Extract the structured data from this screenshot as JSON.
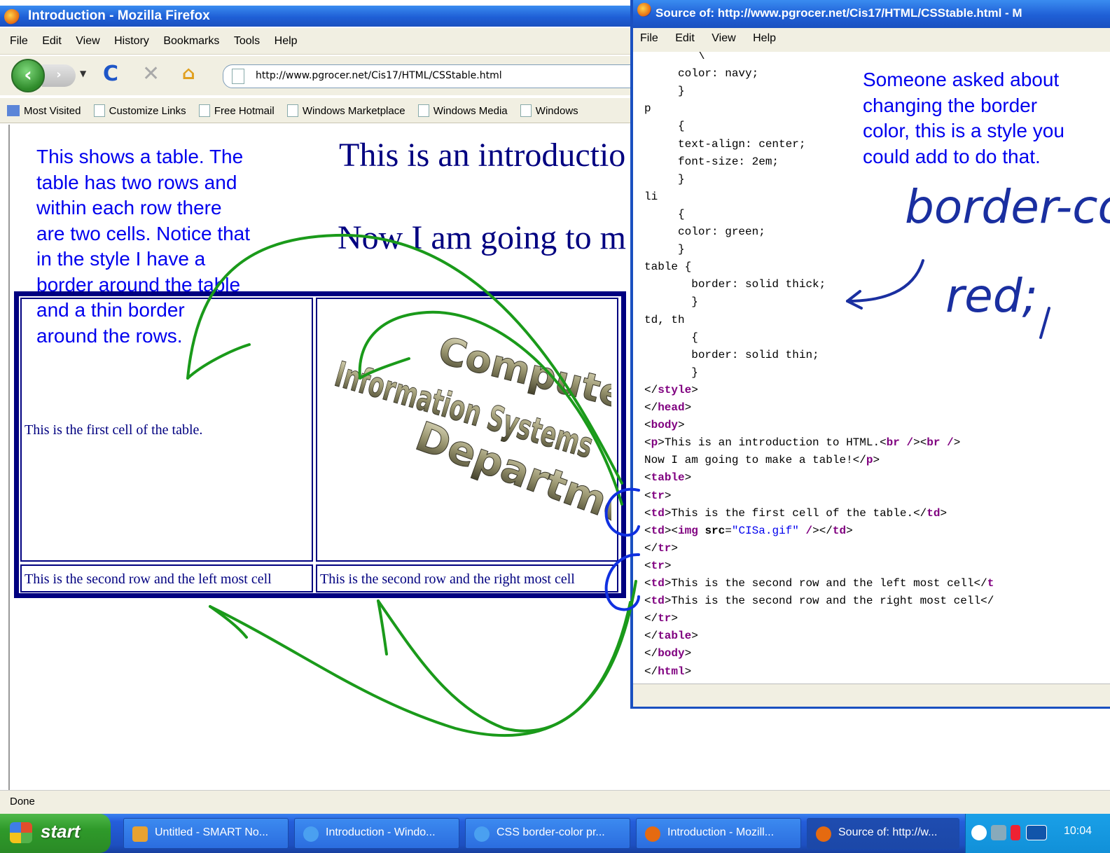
{
  "firefox": {
    "title": "Introduction - Mozilla Firefox",
    "menu": [
      "File",
      "Edit",
      "View",
      "History",
      "Bookmarks",
      "Tools",
      "Help"
    ],
    "url": "http://www.pgrocer.net/Cis17/HTML/CSStable.html",
    "bookmarks": [
      "Most Visited",
      "Customize Links",
      "Free Hotmail",
      "Windows Marketplace",
      "Windows Media",
      "Windows"
    ],
    "status": "Done"
  },
  "page": {
    "line1": "This is an introductio",
    "line2": "Now I am going to m",
    "cell1": "This is the first cell of the table.",
    "cell3": "This is the second row and the left most cell",
    "cell4": "This is the second row and the right most cell",
    "cis_words": [
      "Computer",
      "Information Systems",
      "Department"
    ]
  },
  "source": {
    "title": "Source of: http://www.pgrocer.net/Cis17/HTML/CSStable.html - M",
    "menu": [
      "File",
      "Edit",
      "View",
      "Help"
    ],
    "lines": [
      "        \\",
      "     color: navy;",
      "     }",
      "p",
      "     {",
      "     text-align: center;",
      "     font-size: 2em;",
      "     }",
      "li",
      "     {",
      "     color: green;",
      "     }",
      "table {",
      "       border: solid thick;",
      "       }",
      "td, th",
      "       {",
      "       border: solid thin;",
      "       }"
    ],
    "tail": [
      {
        "parts": [
          [
            "t",
            "</"
          ],
          [
            "g",
            "style"
          ],
          [
            "t",
            ">"
          ]
        ]
      },
      {
        "parts": [
          [
            "t",
            "</"
          ],
          [
            "g",
            "head"
          ],
          [
            "t",
            ">"
          ]
        ]
      },
      {
        "parts": [
          [
            "t",
            "<"
          ],
          [
            "g",
            "body"
          ],
          [
            "t",
            ">"
          ]
        ]
      },
      {
        "parts": [
          [
            "t",
            "<"
          ],
          [
            "g",
            "p"
          ],
          [
            "t",
            ">This is an introduction to HTML.<"
          ],
          [
            "g",
            "br"
          ],
          [
            "t",
            " "
          ],
          [
            "g",
            "/"
          ],
          [
            "t",
            "><"
          ],
          [
            "g",
            "br"
          ],
          [
            "t",
            " "
          ],
          [
            "g",
            "/"
          ],
          [
            "t",
            ">"
          ]
        ]
      },
      {
        "parts": [
          [
            "t",
            "Now I am going to make a table!</"
          ],
          [
            "g",
            "p"
          ],
          [
            "t",
            ">"
          ]
        ]
      },
      {
        "parts": [
          [
            "t",
            "<"
          ],
          [
            "g",
            "table"
          ],
          [
            "t",
            ">"
          ]
        ]
      },
      {
        "parts": [
          [
            "t",
            "<"
          ],
          [
            "g",
            "tr"
          ],
          [
            "t",
            ">"
          ]
        ]
      },
      {
        "parts": [
          [
            "t",
            "<"
          ],
          [
            "g",
            "td"
          ],
          [
            "t",
            ">This is the first cell of the table.</"
          ],
          [
            "g",
            "td"
          ],
          [
            "t",
            ">"
          ]
        ]
      },
      {
        "parts": [
          [
            "t",
            "<"
          ],
          [
            "g",
            "td"
          ],
          [
            "t",
            "><"
          ],
          [
            "g",
            "img"
          ],
          [
            "t",
            " "
          ],
          [
            "a",
            "src"
          ],
          [
            "t",
            "="
          ],
          [
            "s",
            "\"CISa.gif\""
          ],
          [
            "t",
            " "
          ],
          [
            "g",
            "/"
          ],
          [
            "t",
            "></"
          ],
          [
            "g",
            "td"
          ],
          [
            "t",
            ">"
          ]
        ]
      },
      {
        "parts": [
          [
            "t",
            "</"
          ],
          [
            "g",
            "tr"
          ],
          [
            "t",
            ">"
          ]
        ]
      },
      {
        "parts": [
          [
            "t",
            "<"
          ],
          [
            "g",
            "tr"
          ],
          [
            "t",
            ">"
          ]
        ]
      },
      {
        "parts": [
          [
            "t",
            "<"
          ],
          [
            "g",
            "td"
          ],
          [
            "t",
            ">This is the second row and the left most cell</"
          ],
          [
            "g",
            "t"
          ]
        ]
      },
      {
        "parts": [
          [
            "t",
            "<"
          ],
          [
            "g",
            "td"
          ],
          [
            "t",
            ">This is the second row and the right most cell</"
          ]
        ]
      },
      {
        "parts": [
          [
            "t",
            "</"
          ],
          [
            "g",
            "tr"
          ],
          [
            "t",
            ">"
          ]
        ]
      },
      {
        "parts": [
          [
            "t",
            "</"
          ],
          [
            "g",
            "table"
          ],
          [
            "t",
            ">"
          ]
        ]
      },
      {
        "parts": [
          [
            "t",
            "</"
          ],
          [
            "g",
            "body"
          ],
          [
            "t",
            ">"
          ]
        ]
      },
      {
        "parts": [
          [
            "t",
            "</"
          ],
          [
            "g",
            "html"
          ],
          [
            "t",
            ">"
          ]
        ]
      }
    ]
  },
  "annotations": {
    "left_note": [
      "This shows a table. The",
      "table has two rows and",
      "within each row there",
      "are two cells. Notice that",
      "in the style I have a",
      "border around the table",
      "and a thin border",
      "around the rows."
    ],
    "right_note": [
      "Someone asked about",
      "changing the border",
      "color, this is a style you",
      "could add to do that."
    ],
    "handwritten_1": "border-colo",
    "handwritten_2": "red;",
    "ink_color": "#1a9a1a",
    "blue_ink_color": "#1030e0"
  },
  "taskbar": {
    "start": "start",
    "buttons": [
      "Untitled - SMART No...",
      "Introduction - Windo...",
      "CSS border-color pr...",
      "Introduction - Mozill...",
      "Source of: http://w..."
    ],
    "clock": "10:04"
  }
}
